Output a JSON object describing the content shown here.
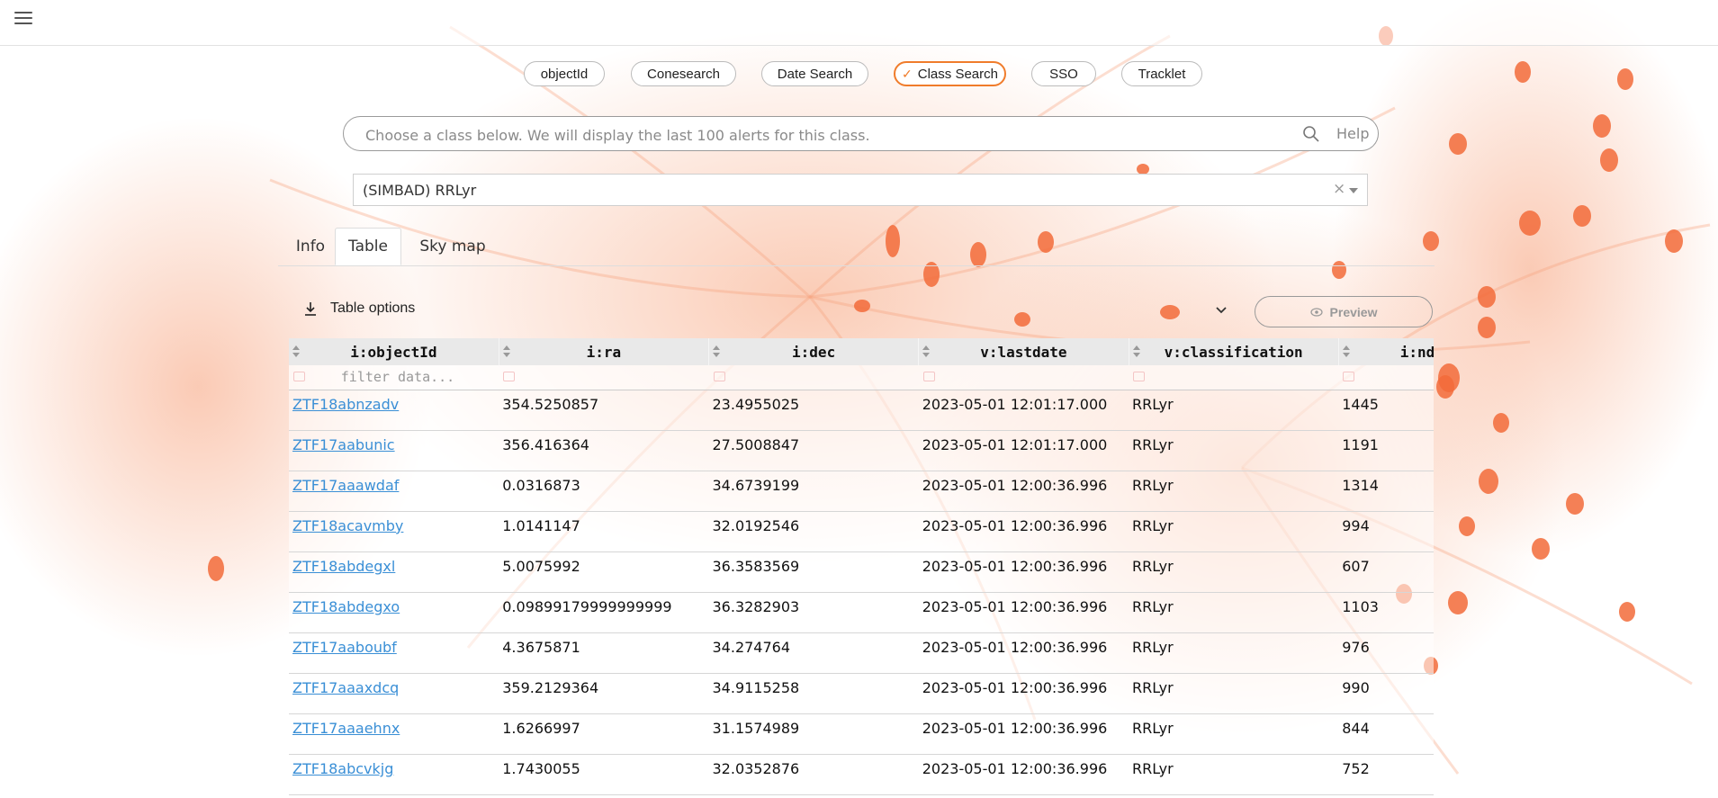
{
  "header": {
    "menu_icon": "hamburger-menu-icon"
  },
  "search_modes": [
    {
      "label": "objectId",
      "active": false
    },
    {
      "label": "Conesearch",
      "active": false
    },
    {
      "label": "Date Search",
      "active": false
    },
    {
      "label": "Class Search",
      "active": true
    },
    {
      "label": "SSO",
      "active": false
    },
    {
      "label": "Tracklet",
      "active": false
    }
  ],
  "search": {
    "placeholder": "Choose a class below. We will display the last 100 alerts for this class.",
    "value": "",
    "icon": "search-icon",
    "help_label": "Help"
  },
  "class_select": {
    "value": "(SIMBAD) RRLyr",
    "clear_symbol": "×"
  },
  "tabs": [
    {
      "label": "Info",
      "active": false
    },
    {
      "label": "Table",
      "active": true
    },
    {
      "label": "Sky map",
      "active": false
    }
  ],
  "toolbar": {
    "table_options_label": "Table options",
    "preview_label": "Preview"
  },
  "table": {
    "columns": [
      "i:objectId",
      "i:ra",
      "i:dec",
      "v:lastdate",
      "v:classification",
      "i:ndethist"
    ],
    "filter_placeholder": "filter data...",
    "rows": [
      [
        "ZTF18abnzadv",
        "354.5250857",
        "23.4955025",
        "2023-05-01 12:01:17.000",
        "RRLyr",
        "1445"
      ],
      [
        "ZTF17aabunic",
        "356.416364",
        "27.5008847",
        "2023-05-01 12:01:17.000",
        "RRLyr",
        "1191"
      ],
      [
        "ZTF17aaawdaf",
        "0.0316873",
        "34.6739199",
        "2023-05-01 12:00:36.996",
        "RRLyr",
        "1314"
      ],
      [
        "ZTF18acavmby",
        "1.0141147",
        "32.0192546",
        "2023-05-01 12:00:36.996",
        "RRLyr",
        "994"
      ],
      [
        "ZTF18abdegxl",
        "5.0075992",
        "36.3583569",
        "2023-05-01 12:00:36.996",
        "RRLyr",
        "607"
      ],
      [
        "ZTF18abdegxo",
        "0.09899179999999999",
        "36.3282903",
        "2023-05-01 12:00:36.996",
        "RRLyr",
        "1103"
      ],
      [
        "ZTF17aaboubf",
        "4.3675871",
        "34.274764",
        "2023-05-01 12:00:36.996",
        "RRLyr",
        "976"
      ],
      [
        "ZTF17aaaxdcq",
        "359.2129364",
        "34.9115258",
        "2023-05-01 12:00:36.996",
        "RRLyr",
        "990"
      ],
      [
        "ZTF17aaaehnx",
        "1.6266997",
        "31.1574989",
        "2023-05-01 12:00:36.996",
        "RRLyr",
        "844"
      ],
      [
        "ZTF18abcvkjg",
        "1.7430055",
        "32.0352876",
        "2023-05-01 12:00:36.996",
        "RRLyr",
        "752"
      ]
    ]
  },
  "colors": {
    "accent": "#f07c2b",
    "link": "#3a8fd6",
    "background_splash": "#f26b3a"
  }
}
